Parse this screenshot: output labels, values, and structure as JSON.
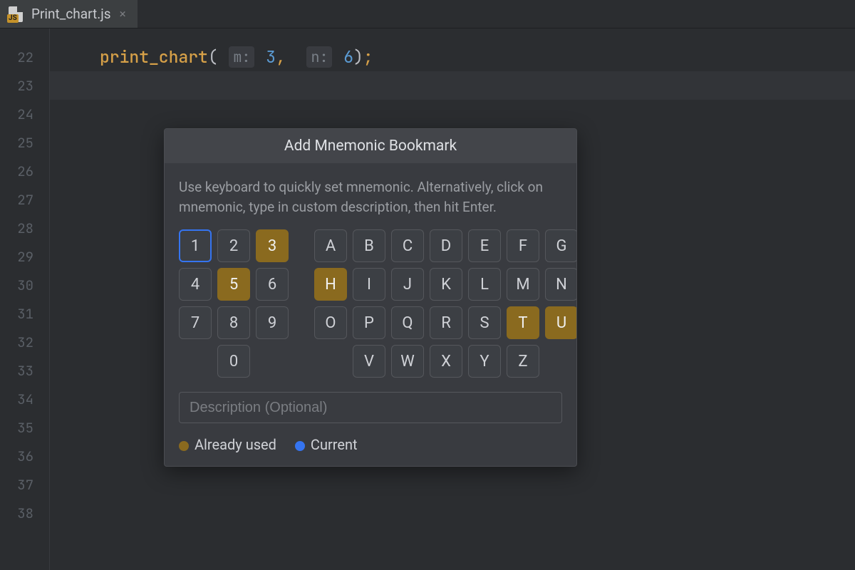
{
  "tab": {
    "filename": "Print_chart.js",
    "icon_badge": "JS"
  },
  "gutter": {
    "start": 22,
    "count": 17
  },
  "code": {
    "fn": "print_chart",
    "hint_m": "m:",
    "val_m": "3",
    "hint_n": "n:",
    "val_n": "6"
  },
  "popup": {
    "title": "Add Mnemonic Bookmark",
    "hint": "Use keyboard to quickly set mnemonic. Alternatively, click on mnemonic, type in custom description, then hit Enter.",
    "num_keys": [
      "1",
      "2",
      "3",
      "4",
      "5",
      "6",
      "7",
      "8",
      "9",
      "0"
    ],
    "alpha_keys": [
      "A",
      "B",
      "C",
      "D",
      "E",
      "F",
      "G",
      "H",
      "I",
      "J",
      "K",
      "L",
      "M",
      "N",
      "O",
      "P",
      "Q",
      "R",
      "S",
      "T",
      "U",
      "V",
      "W",
      "X",
      "Y",
      "Z"
    ],
    "used": [
      "3",
      "5",
      "H",
      "T",
      "U"
    ],
    "current": "1",
    "desc_placeholder": "Description (Optional)",
    "legend_used": "Already used",
    "legend_current": "Current"
  }
}
